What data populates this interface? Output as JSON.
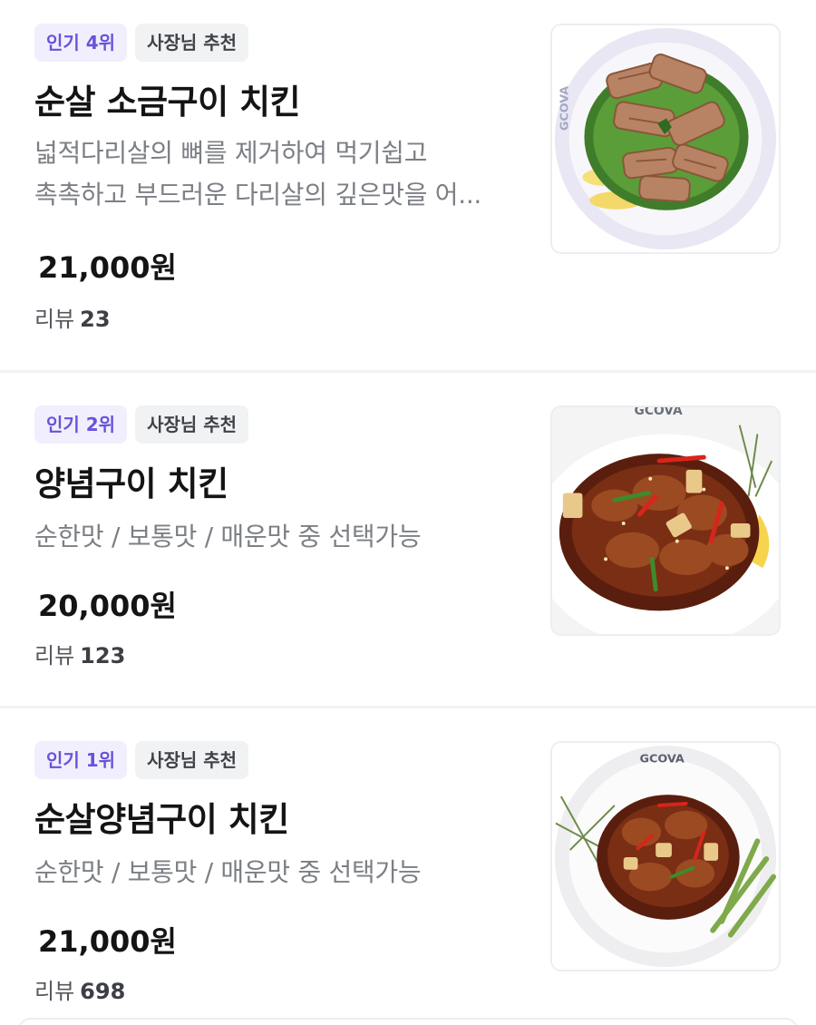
{
  "menu": {
    "items": [
      {
        "rank_badge": "인기 4위",
        "owner_badge": "사장님 추천",
        "name": "순살 소금구이 치킨",
        "description_lines": [
          "넓적다리살의 뼈를 제거하여 먹기쉽고",
          "촉촉하고 부드러운 다리살의 깊은맛을 어..."
        ],
        "price": "21,000원",
        "review_label": "리뷰",
        "review_count": "23",
        "image": {
          "type": "salt-grilled-boneless-chicken",
          "plate_text": "GCOVA"
        }
      },
      {
        "rank_badge": "인기 2위",
        "owner_badge": "사장님 추천",
        "name": "양념구이 치킨",
        "description_lines": [
          "순한맛 / 보통맛 / 매운맛 중 선택가능"
        ],
        "price": "20,000원",
        "review_label": "리뷰",
        "review_count": "123",
        "image": {
          "type": "seasoned-grilled-chicken",
          "plate_text": "GCOVA"
        }
      },
      {
        "rank_badge": "인기 1위",
        "owner_badge": "사장님 추천",
        "name": "순살양념구이 치킨",
        "description_lines": [
          "순한맛 / 보통맛 / 매운맛 중 선택가능"
        ],
        "price": "21,000원",
        "review_label": "리뷰",
        "review_count": "698",
        "image": {
          "type": "seasoned-grilled-boneless-chicken",
          "plate_text": "GCOVA"
        }
      }
    ]
  },
  "colors": {
    "rank_badge_bg": "#f1effd",
    "rank_badge_text": "#6a52d9",
    "owner_badge_bg": "#f1f2f4",
    "description_text": "#7c7f85",
    "divider": "#f1f2f4"
  }
}
